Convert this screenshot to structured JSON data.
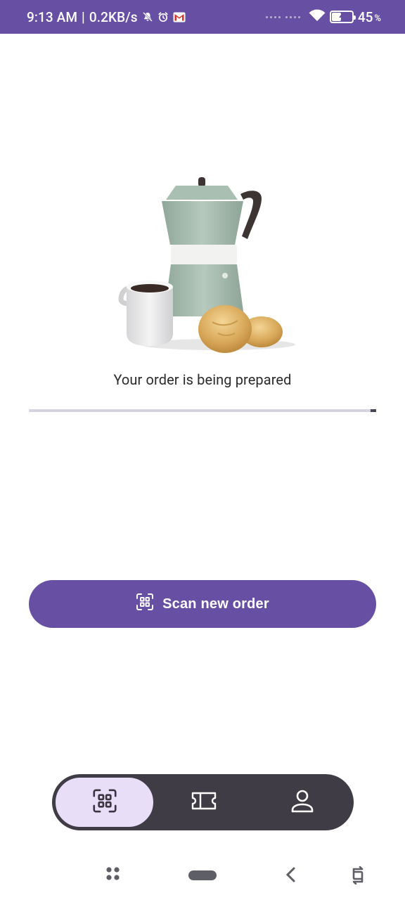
{
  "status_bar": {
    "time": "9:13 AM",
    "separator": "|",
    "network_speed": "0.2KB/s",
    "battery_percent": "45",
    "battery_unit": "%",
    "battery_level": 0.45,
    "background_color": "#6750a4"
  },
  "main": {
    "illustration": "moka-pot-coffee-cup-buns-illustration",
    "status_message": "Your order is being prepared",
    "progress": 1.0
  },
  "actions": {
    "scan_label": "Scan new order",
    "scan_icon": "qr-scan-icon",
    "accent_color": "#6750a4"
  },
  "bottom_nav": {
    "items": [
      {
        "icon": "qr-scan-icon",
        "active": true
      },
      {
        "icon": "ticket-icon",
        "active": false
      },
      {
        "icon": "person-icon",
        "active": false
      }
    ],
    "active_color": "#e8def8",
    "background_color": "#403c45"
  },
  "system_nav": {
    "items": [
      "menu-dots-icon",
      "home-pill-icon",
      "back-chevron-icon",
      "rotate-icon"
    ]
  }
}
